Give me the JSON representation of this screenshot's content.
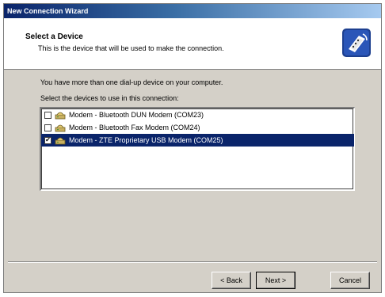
{
  "window": {
    "title": "New Connection Wizard"
  },
  "header": {
    "title": "Select a Device",
    "subtitle": "This is the device that will be used to make the connection.",
    "icon": "modem-wizard-icon"
  },
  "body": {
    "intro": "You have more than one dial-up device on your computer.",
    "instruction": "Select the devices to use in this connection:"
  },
  "devices": [
    {
      "label": "Modem - Bluetooth DUN Modem (COM23)",
      "checked": false,
      "selected": false
    },
    {
      "label": "Modem - Bluetooth Fax Modem (COM24)",
      "checked": false,
      "selected": false
    },
    {
      "label": "Modem - ZTE Proprietary USB Modem (COM25)",
      "checked": true,
      "selected": true
    }
  ],
  "buttons": {
    "back": "< Back",
    "next": "Next >",
    "cancel": "Cancel"
  },
  "colors": {
    "selection": "#0a246a",
    "title_gradient_start": "#0a246a",
    "face": "#d4d0c8"
  }
}
